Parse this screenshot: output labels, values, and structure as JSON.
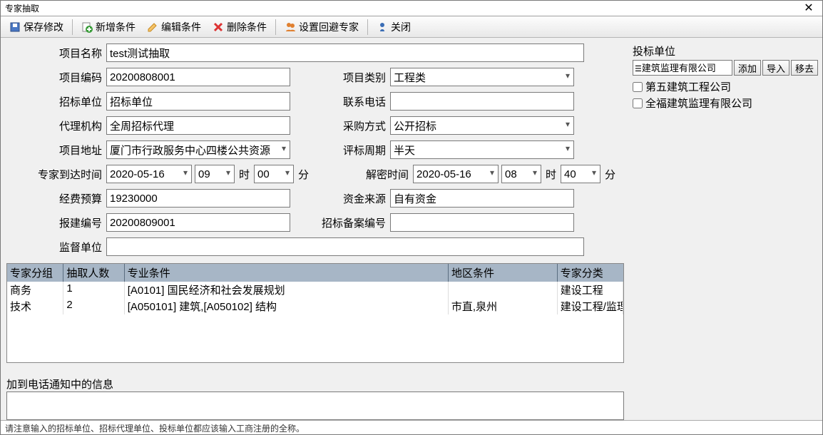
{
  "window": {
    "title": "专家抽取",
    "close": "✕"
  },
  "toolbar": {
    "save": "保存修改",
    "add": "新增条件",
    "edit": "编辑条件",
    "del": "删除条件",
    "avoid": "设置回避专家",
    "close": "关闭"
  },
  "labels": {
    "proj_name": "项目名称",
    "proj_code": "项目编码",
    "proj_type": "项目类别",
    "tender_unit": "招标单位",
    "contact": "联系电话",
    "agency": "代理机构",
    "purchase": "采购方式",
    "addr": "项目地址",
    "eval_period": "评标周期",
    "arrive": "专家到达时间",
    "hour": "时",
    "min": "分",
    "decrypt": "解密时间",
    "budget": "经费预算",
    "fund": "资金来源",
    "report_code": "报建编号",
    "filing_code": "招标备案编号",
    "supervise": "监督单位",
    "note_title": "加到电话通知中的信息"
  },
  "values": {
    "proj_name": "test测试抽取",
    "proj_code": "20200808001",
    "proj_type": "工程类",
    "tender_unit": "招标单位",
    "contact": "",
    "agency": "全周招标代理",
    "purchase": "公开招标",
    "addr": "厦门市行政服务中心四楼公共资源",
    "eval_period": "半天",
    "arrive_date": "2020-05-16",
    "arrive_h": "09",
    "arrive_m": "00",
    "decrypt_date": "2020-05-16",
    "decrypt_h": "08",
    "decrypt_m": "40",
    "budget": "19230000",
    "fund": "自有资金",
    "report_code": "20200809001",
    "filing_code": "",
    "supervise": ""
  },
  "grid": {
    "headers": [
      "专家分组",
      "抽取人数",
      "专业条件",
      "地区条件",
      "专家分类"
    ],
    "rows": [
      {
        "group": "商务",
        "count": "1",
        "major": "[A0101] 国民经济和社会发展规划",
        "region": "",
        "cat": "建设工程"
      },
      {
        "group": "技术",
        "count": "2",
        "major": "[A050101] 建筑,[A050102] 结构",
        "region": "市直,泉州",
        "cat": "建设工程/监理"
      }
    ]
  },
  "right": {
    "title": "投标单位",
    "selected": "建筑监理有限公司",
    "btn_add": "添加",
    "btn_import": "导入",
    "btn_remove": "移去",
    "items": [
      "第五建筑工程公司",
      "全福建筑监理有限公司"
    ]
  },
  "footer": "请注意输入的招标单位、招标代理单位、投标单位都应该输入工商注册的全称。"
}
